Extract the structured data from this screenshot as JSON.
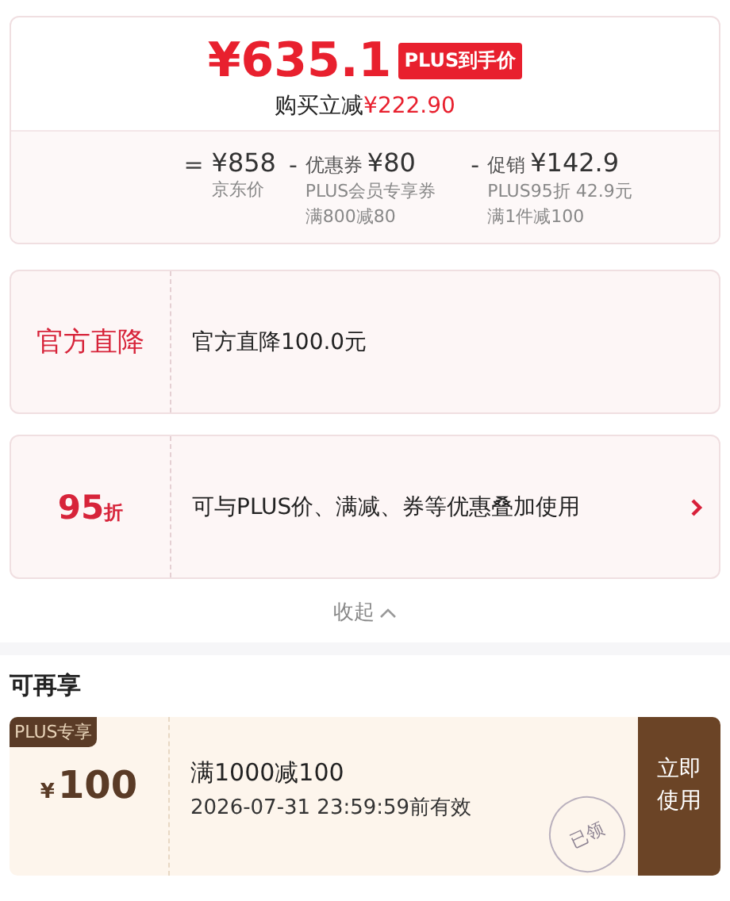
{
  "price_summary": {
    "price": "¥635.1",
    "badge": "PLUS到手价",
    "saving_label": "购买立减",
    "saving": "¥222.90",
    "breakdown": [
      {
        "operator": "=",
        "amount": "¥858",
        "notes": [
          "京东价"
        ]
      },
      {
        "operator": "-",
        "label": "优惠券",
        "amount": "¥80",
        "notes": [
          "PLUS会员专享券",
          "满800减80"
        ]
      },
      {
        "operator": "-",
        "label": "促销",
        "amount": "¥142.9",
        "notes": [
          "PLUS95折 42.9元",
          "满1件减100"
        ]
      }
    ]
  },
  "promotions": [
    {
      "kind": "text",
      "title": "官方直降",
      "description": "官方直降100.0元",
      "has_arrow": false
    },
    {
      "kind": "discount",
      "title": "95",
      "unit": "折",
      "description": "可与PLUS价、满减、券等优惠叠加使用",
      "has_arrow": true
    }
  ],
  "collapse_label": "收起",
  "extra_section": {
    "title": "可再享",
    "coupons": [
      {
        "tag": "PLUS专享",
        "currency": "¥",
        "amount": "100",
        "condition": "满1000减100",
        "validity": "2026-07-31 23:59:59前有效",
        "claimed": true,
        "stamp": "已领",
        "button": "立即使用"
      }
    ]
  }
}
